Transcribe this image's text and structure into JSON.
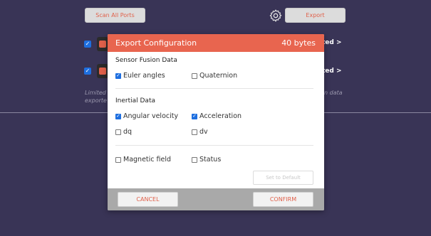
{
  "background": {
    "scan_button_label": "Scan All Ports",
    "export_button_label": "Export",
    "device_status_1": "ted >",
    "device_status_2": "ted >",
    "note_left_1": "Limited",
    "note_left_2": "exporte",
    "note_right": "n data"
  },
  "modal": {
    "title": "Export Configuration",
    "size": "40 bytes",
    "sensor_fusion": {
      "heading": "Sensor Fusion Data",
      "options": [
        {
          "label": "Euler angles",
          "checked": true
        },
        {
          "label": "Quaternion",
          "checked": false
        }
      ]
    },
    "inertial": {
      "heading": "Inertial Data",
      "options": [
        {
          "label": "Angular velocity",
          "checked": true
        },
        {
          "label": "Acceleration",
          "checked": true
        },
        {
          "label": "dq",
          "checked": false
        },
        {
          "label": "dv",
          "checked": false
        }
      ]
    },
    "other": {
      "options": [
        {
          "label": "Magnetic field",
          "checked": false
        },
        {
          "label": "Status",
          "checked": false
        }
      ]
    },
    "set_default_label": "Set to Default",
    "cancel_label": "CANCEL",
    "confirm_label": "CONFIRM"
  },
  "colors": {
    "background": "#393456",
    "accent": "#e8654f",
    "check_blue": "#1e6fe0"
  }
}
